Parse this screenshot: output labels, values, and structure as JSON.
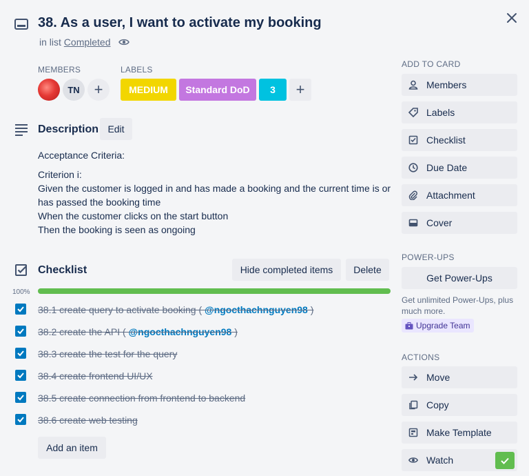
{
  "card": {
    "title": "38. As a user, I want to activate my booking",
    "in_list_prefix": "in list ",
    "list_name": "Completed"
  },
  "members": {
    "heading": "MEMBERS",
    "people": [
      {
        "type": "photo",
        "initials": ""
      },
      {
        "type": "initials",
        "initials": "TN"
      }
    ],
    "add_symbol": "+"
  },
  "labels": {
    "heading": "LABELS",
    "items": [
      {
        "text": "MEDIUM",
        "color": "#f2d600"
      },
      {
        "text": "Standard DoD",
        "color": "#c377e0"
      },
      {
        "text": "3",
        "color": "#00c2e0"
      }
    ],
    "add_symbol": "+"
  },
  "description": {
    "heading": "Description",
    "edit_label": "Edit",
    "lines": [
      "Acceptance Criteria:",
      "Criterion i:",
      "Given the customer is logged in and has made a booking and the current time is or",
      "has passed the booking time",
      "When the customer clicks on the start button",
      "Then the booking is seen as ongoing"
    ]
  },
  "checklist": {
    "heading": "Checklist",
    "hide_label": "Hide completed items",
    "delete_label": "Delete",
    "progress_text": "100%",
    "progress_value": 1.0,
    "items": [
      {
        "text": "38.1 create query to activate booking ( ",
        "mention": "@ngocthachnguyen98",
        "suffix": " )"
      },
      {
        "text": "38.2 create the API ( ",
        "mention": "@ngocthachnguyen98",
        "suffix": " )"
      },
      {
        "text": "38.3 create the test for the query",
        "mention": "",
        "suffix": ""
      },
      {
        "text": "38.4 create frontend UI/UX",
        "mention": "",
        "suffix": ""
      },
      {
        "text": "38.5 create connection from frontend to backend",
        "mention": "",
        "suffix": ""
      },
      {
        "text": "38.6 create web testing",
        "mention": "",
        "suffix": ""
      }
    ],
    "add_item_label": "Add an item"
  },
  "sidebar": {
    "add_to_card_heading": "ADD TO CARD",
    "add_to_card": [
      {
        "label": "Members",
        "icon": "person-icon"
      },
      {
        "label": "Labels",
        "icon": "tag-icon"
      },
      {
        "label": "Checklist",
        "icon": "checklist-icon"
      },
      {
        "label": "Due Date",
        "icon": "clock-icon"
      },
      {
        "label": "Attachment",
        "icon": "paperclip-icon"
      },
      {
        "label": "Cover",
        "icon": "cover-icon"
      }
    ],
    "powerups_heading": "POWER-UPS",
    "get_powerups_label": "Get Power-Ups",
    "promo_text": "Get unlimited Power-Ups, plus much more.",
    "upgrade_label": "Upgrade Team",
    "actions_heading": "ACTIONS",
    "actions": [
      {
        "label": "Move",
        "icon": "arrow-right-icon"
      },
      {
        "label": "Copy",
        "icon": "copy-icon"
      },
      {
        "label": "Make Template",
        "icon": "template-icon"
      },
      {
        "label": "Watch",
        "icon": "eye-icon"
      }
    ]
  },
  "colors": {
    "accent": "#0079bf",
    "progress": "#61bd4f",
    "button_bg": "#ebecf0"
  }
}
